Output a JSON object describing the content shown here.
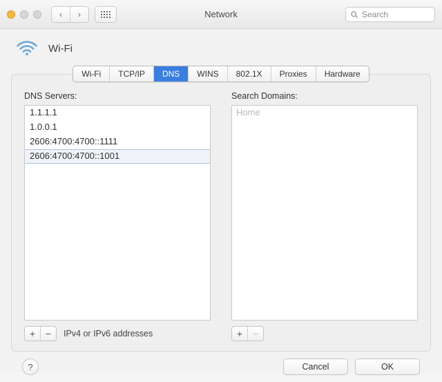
{
  "window": {
    "title": "Network"
  },
  "toolbar": {
    "search_placeholder": "Search"
  },
  "connection": {
    "name": "Wi-Fi"
  },
  "tabs": [
    {
      "label": "Wi-Fi",
      "active": false
    },
    {
      "label": "TCP/IP",
      "active": false
    },
    {
      "label": "DNS",
      "active": true
    },
    {
      "label": "WINS",
      "active": false
    },
    {
      "label": "802.1X",
      "active": false
    },
    {
      "label": "Proxies",
      "active": false
    },
    {
      "label": "Hardware",
      "active": false
    }
  ],
  "dns": {
    "label": "DNS Servers:",
    "servers": [
      {
        "value": "1.1.1.1",
        "selected": false
      },
      {
        "value": "1.0.0.1",
        "selected": false
      },
      {
        "value": "2606:4700:4700::1111",
        "selected": false
      },
      {
        "value": "2606:4700:4700::1001",
        "selected": true
      }
    ],
    "hint": "IPv4 or IPv6 addresses"
  },
  "search_domains": {
    "label": "Search Domains:",
    "placeholder": "Home",
    "domains": []
  },
  "buttons": {
    "cancel": "Cancel",
    "ok": "OK",
    "help": "?",
    "plus": "+",
    "minus": "−"
  }
}
